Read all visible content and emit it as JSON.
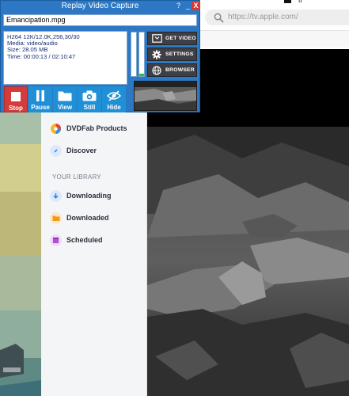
{
  "browser": {
    "tab_text": "tf",
    "address_placeholder": "https://tv.apple.com/"
  },
  "sidebar": {
    "items": [
      {
        "label": "DVDFab Products",
        "icon": "dvdfab-logo-icon"
      },
      {
        "label": "Discover",
        "icon": "compass-icon"
      }
    ],
    "library_heading": "YOUR LIBRARY",
    "library_items": [
      {
        "label": "Downloading",
        "icon": "download-arrow-icon"
      },
      {
        "label": "Downloaded",
        "icon": "folder-icon"
      },
      {
        "label": "Scheduled",
        "icon": "calendar-icon"
      }
    ]
  },
  "rvc": {
    "title": "Replay Video Capture",
    "help_label": "?",
    "minimize_label": "_",
    "close_label": "X",
    "file_name": "Emancipation.mpg",
    "info": [
      "H264 12K/12.0K,256,30/30",
      "Media: video/audio",
      "Size: 28.05  MB",
      "Time: 00:00:13  / 02:10:47"
    ],
    "meters": [
      0.0,
      0.05
    ],
    "side_buttons": [
      {
        "label": "GET VIDEO",
        "icon": "get-video-icon"
      },
      {
        "label": "SETTINGS",
        "icon": "gear-icon"
      },
      {
        "label": "BROWSER",
        "icon": "globe-icon"
      }
    ],
    "controls": [
      {
        "label": "Stop",
        "icon": "stop-icon"
      },
      {
        "label": "Pause",
        "icon": "pause-icon"
      },
      {
        "label": "View",
        "icon": "folder-icon"
      },
      {
        "label": "Still",
        "icon": "camera-icon"
      },
      {
        "label": "Hide",
        "icon": "eye-slash-icon"
      }
    ]
  },
  "colors": {
    "rvc_blue": "#2d78c4",
    "control_blue": "#1f8fd6",
    "stop_red": "#d43b3b",
    "meter_green": "#27c23a",
    "dark_button": "#3d3f44"
  }
}
